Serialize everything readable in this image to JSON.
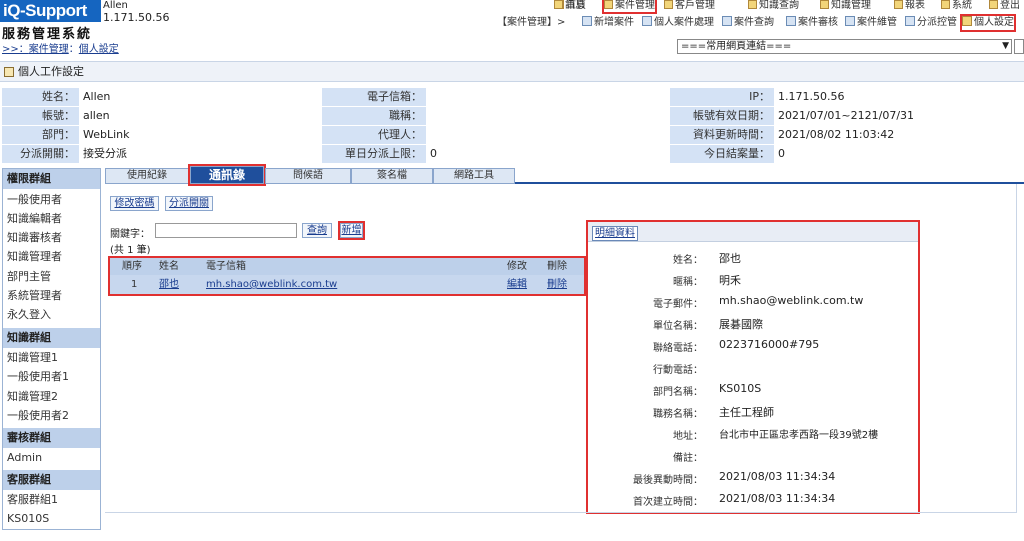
{
  "header": {
    "logo": "iQ-Support",
    "user_name": "Allen",
    "user_ip": "1.171.50.56",
    "system_title": "服務管理系統",
    "breadcrumb_prefix": ">>：",
    "breadcrumb": [
      "案件管理",
      "個人設定"
    ]
  },
  "topnav": [
    "首頁",
    "訊息",
    "案件管理",
    "客戶管理",
    "知識查詢",
    "知識管理",
    "報表",
    "系統",
    "登出"
  ],
  "subnav": {
    "section": "【案件管理】>",
    "items": [
      "新增案件",
      "個人案件處理",
      "案件查詢",
      "案件審核",
      "案件維管",
      "分派控管",
      "個人設定"
    ]
  },
  "quick_select": {
    "value": "===常用網頁連結==="
  },
  "page_title": "個人工作設定",
  "info": {
    "name_label": "姓名：",
    "name": "Allen",
    "email_label": "電子信箱：",
    "email": "",
    "ip_label": "IP：",
    "ip": "1.171.50.56",
    "account_label": "帳號：",
    "account": "allen",
    "title_label": "職稱：",
    "title": "",
    "valid_label": "帳號有效日期：",
    "valid": "2021/07/01~2121/07/31",
    "dept_label": "部門：",
    "dept": "WebLink",
    "agent_label": "代理人：",
    "agent": "",
    "updated_label": "資料更新時間：",
    "updated": "2021/08/02 11:03:42",
    "dispatch_label": "分派開關：",
    "dispatch": "接受分派",
    "daily_limit_label": "單日分派上限：",
    "daily_limit": "0",
    "closed_label": "今日結案量：",
    "closed": "0"
  },
  "sidebar": {
    "groups": [
      {
        "title": "權限群組",
        "items": [
          "一般使用者",
          "知識編輯者",
          "知識審核者",
          "知識管理者",
          "部門主管",
          "系統管理者",
          "永久登入"
        ]
      },
      {
        "title": "知識群組",
        "items": [
          "知識管理1",
          "一般使用者1",
          "知識管理2",
          "一般使用者2"
        ]
      },
      {
        "title": "審核群組",
        "items": [
          "Admin"
        ]
      },
      {
        "title": "客服群組",
        "items": [
          "客服群組1",
          "KS010S"
        ]
      }
    ]
  },
  "tabs": [
    "使用紀錄",
    "通訊錄",
    "問候語",
    "簽名檔",
    "網路工具"
  ],
  "actions": {
    "change_password": "修改密碼",
    "dispatch_switch": "分派開關"
  },
  "search": {
    "label": "關鍵字：",
    "value": "",
    "query_button": "查詢",
    "add_button": "新增",
    "count": "(共 1 筆)"
  },
  "contacts": {
    "headers": [
      "順序",
      "姓名",
      "電子信箱",
      "修改",
      "刪除"
    ],
    "rows": [
      {
        "order": "1",
        "name": "邵也",
        "email": "mh.shao@weblink.com.tw",
        "edit": "編輯",
        "delete": "刪除"
      }
    ]
  },
  "detail": {
    "tab": "明細資料",
    "fields": [
      {
        "label": "姓名：",
        "value": "邵也"
      },
      {
        "label": "暱稱：",
        "value": "明禾"
      },
      {
        "label": "電子郵件：",
        "value": "mh.shao@weblink.com.tw"
      },
      {
        "label": "單位名稱：",
        "value": "展碁國際"
      },
      {
        "label": "聯絡電話：",
        "value": "0223716000#795"
      },
      {
        "label": "行動電話：",
        "value": ""
      },
      {
        "label": "部門名稱：",
        "value": "KS010S"
      },
      {
        "label": "職務名稱：",
        "value": "主任工程師"
      },
      {
        "label": "地址：",
        "value": "台北市中正區忠孝西路一段39號2樓"
      },
      {
        "label": "備註：",
        "value": ""
      },
      {
        "label": "最後異動時間：",
        "value": "2021/08/03 11:34:34"
      },
      {
        "label": "首次建立時間：",
        "value": "2021/08/03 11:34:34"
      }
    ]
  },
  "colors": {
    "brand": "#1565c0",
    "tab_active": "#1f4f9c",
    "label_bg": "#d4e2f5",
    "highlight": "#e03030"
  }
}
